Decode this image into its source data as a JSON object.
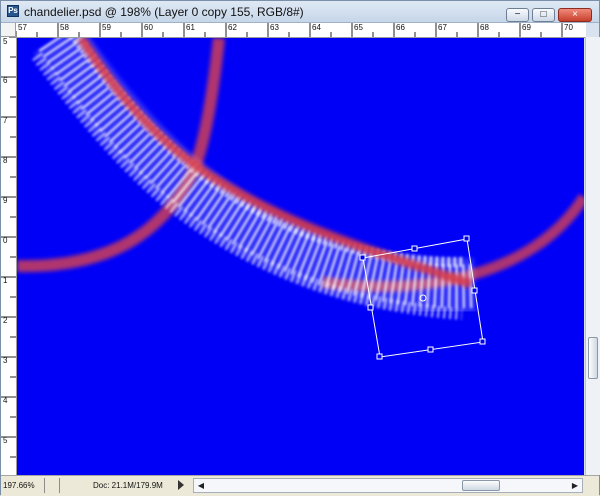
{
  "window": {
    "title": "chandelier.psd @ 198% (Layer 0 copy 155, RGB/8#)",
    "controls": [
      "−",
      "□",
      "×"
    ]
  },
  "ruler": {
    "top_ticks": [
      "57",
      "58",
      "59",
      "60",
      "61",
      "62",
      "63",
      "64",
      "65",
      "66",
      "67",
      "68",
      "69",
      "70"
    ],
    "left_ticks": [
      "5",
      "6",
      "7",
      "8",
      "9",
      "0",
      "1",
      "2",
      "3",
      "4",
      "5"
    ]
  },
  "status": {
    "zoom": "197.66%",
    "doc": "Doc: 21.1M/179.9M"
  },
  "colors": {
    "canvas": "#0000f7",
    "accent_red": "#d53b4c",
    "white": "#ffffff"
  }
}
